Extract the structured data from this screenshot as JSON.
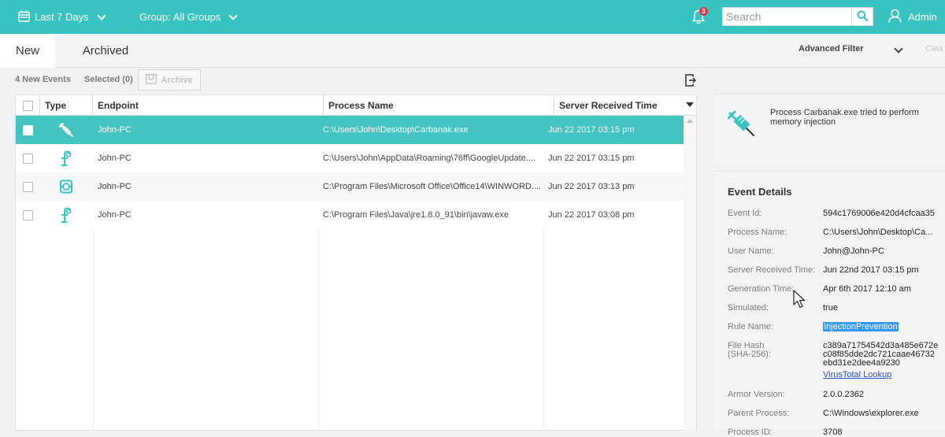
{
  "topbar": {
    "date_range": "Last 7 Days",
    "group": "Group: All Groups",
    "notification_count": "3",
    "search_placeholder": "Search",
    "user": "Admin"
  },
  "tabs": [
    {
      "label": "New"
    },
    {
      "label": "Archived"
    }
  ],
  "filter": {
    "advanced_label": "Advanced Filter",
    "clear_label": "Clea"
  },
  "toolbar": {
    "new_events": "4  New Events",
    "selected": "Selected  (0)",
    "archive_label": "Archive"
  },
  "table": {
    "columns": [
      "Type",
      "Endpoint",
      "Process Name",
      "Server Received Time"
    ],
    "rows": [
      {
        "type_icon": "syringe-icon",
        "endpoint": "John-PC",
        "process": "C:\\Users\\John\\Desktop\\Carbanak.exe",
        "time": "Jun 22 2017 03:15 pm"
      },
      {
        "type_icon": "script-icon",
        "endpoint": "John-PC",
        "process": "C:\\Users\\John\\AppData\\Roaming\\76ff\\GoogleUpdate....",
        "time": "Jun 22 2017 03:15 pm"
      },
      {
        "type_icon": "document-macro-icon",
        "endpoint": "John-PC",
        "process": "C:\\Program Files\\Microsoft Office\\Office14\\WINWORD....",
        "time": "Jun 22 2017 03:13 pm"
      },
      {
        "type_icon": "script-icon",
        "endpoint": "John-PC",
        "process": "C:\\Program Files\\Java\\jre1.8.0_91\\bin\\javaw.exe",
        "time": "Jun 22 2017 03:08 pm"
      }
    ]
  },
  "summary": {
    "icon": "syringe-icon",
    "text": "Process Carbanak.exe tried to perform memory injection"
  },
  "details": {
    "title": "Event Details",
    "fields": [
      {
        "label": "Event Id:",
        "value": "594c1769006e420d4cfcaa35"
      },
      {
        "label": "Process Name:",
        "value": "C:\\Users\\John\\Desktop\\Ca..."
      },
      {
        "label": "User Name:",
        "value": "John@John-PC"
      },
      {
        "label": "Server Received Time:",
        "value": "Jun 22nd 2017 03:15 pm"
      },
      {
        "label": "Generation Time:",
        "value": "Apr 6th 2017 12:10 am"
      },
      {
        "label": "Simulated:",
        "value": "true"
      },
      {
        "label": "Rule Name:",
        "value": "InjectionPrevention"
      },
      {
        "label": "File Hash",
        "label2": "(SHA-256):",
        "value": "c389a71754542d3a485e672e",
        "value2": "c08f85dde2dc721caae46732",
        "value3": "ebd31e2dee4a9230",
        "link": "VirusTotal Lookup"
      },
      {
        "label": "Armor Version:",
        "value": "2.0.0.2362"
      },
      {
        "label": "Parent Process:",
        "value": "C:\\Windows\\explorer.exe"
      },
      {
        "label": "Process ID:",
        "value": "3708"
      }
    ]
  },
  "colors": {
    "accent": "#37c3c0",
    "selected_row": "#43c4c1",
    "badge": "#e2334d",
    "selection_highlight": "#3399ff"
  }
}
